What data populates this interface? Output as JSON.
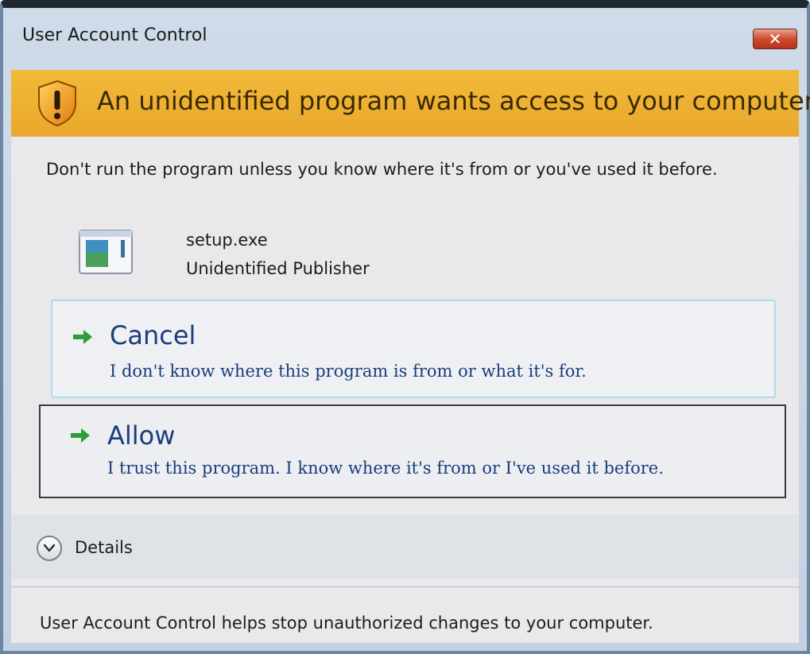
{
  "window": {
    "title": "User Account Control",
    "close_label": "✕"
  },
  "banner": {
    "headline": "An unidentified program wants access to your computer",
    "icon": "shield-warning-icon"
  },
  "body": {
    "warning": "Don't run the program unless you know where it's from or you've used it before.",
    "program": {
      "name": "setup.exe",
      "publisher": "Unidentified Publisher",
      "icon": "program-window-icon"
    }
  },
  "options": {
    "cancel": {
      "label": "Cancel",
      "description": "I don't know where this program is from or what it's for.",
      "icon": "arrow-right-icon"
    },
    "allow": {
      "label": "Allow",
      "description": "I trust this program. I know where it's from or I've used it before.",
      "icon": "arrow-right-icon"
    }
  },
  "details": {
    "label": "Details",
    "icon": "chevron-down-icon"
  },
  "footer": {
    "text": "User Account Control helps stop unauthorized changes to your computer."
  },
  "colors": {
    "banner": "#e9a82c",
    "option_text": "#1b3d7a",
    "arrow": "#2e9e3a",
    "close_button": "#cf4b2f"
  }
}
